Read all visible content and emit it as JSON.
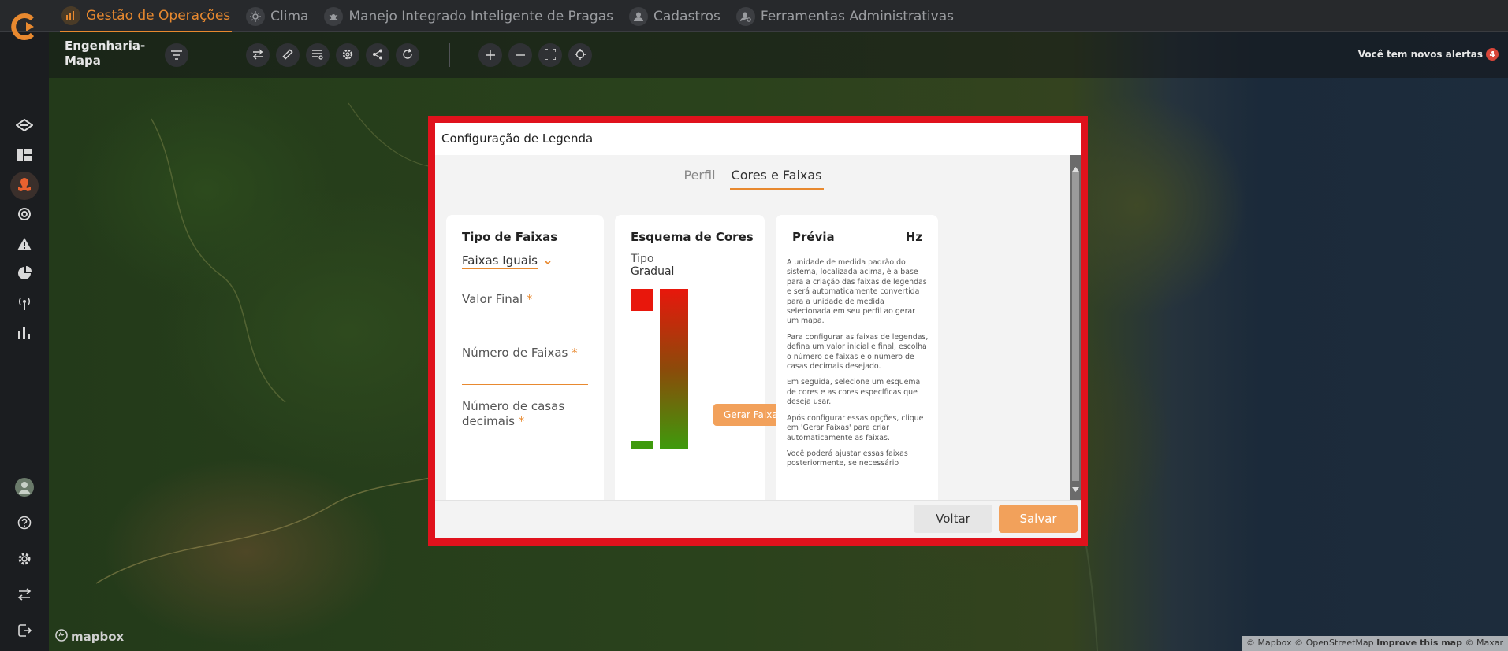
{
  "nav": {
    "items": [
      {
        "label": "Gestão de Operações",
        "active": true
      },
      {
        "label": "Clima",
        "active": false
      },
      {
        "label": "Manejo Integrado Inteligente de Pragas",
        "active": false
      },
      {
        "label": "Cadastros",
        "active": false
      },
      {
        "label": "Ferramentas Administrativas",
        "active": false
      }
    ]
  },
  "map": {
    "title": "Engenharia-Mapa",
    "alerts_label": "Você tem novos alertas",
    "alerts_count": "4",
    "brand": "mapbox",
    "attribution": {
      "mapbox": "© Mapbox",
      "osm": "© OpenStreetMap",
      "improve": "Improve this map",
      "maxar": "© Maxar"
    }
  },
  "modal": {
    "title": "Configuração de Legenda",
    "tabs": [
      {
        "label": "Perfil",
        "active": false
      },
      {
        "label": "Cores e Faixas",
        "active": true
      }
    ],
    "tipo_faixas": {
      "title": "Tipo de Faixas",
      "selected": "Faixas Iguais",
      "valor_final_label": "Valor Final",
      "numero_faixas_label": "Número de Faixas",
      "casas_decimais_label": "Número de casas decimais",
      "required_mark": "*"
    },
    "esquema_cores": {
      "title": "Esquema de Cores",
      "tipo_label": "Tipo",
      "tipo_value": "Gradual",
      "gerar_button": "Gerar Faixas",
      "color_start": "#e8170c",
      "color_end": "#3e9a0c"
    },
    "previa": {
      "title": "Prévia",
      "unit": "Hz",
      "help": [
        "A unidade de medida padrão do sistema, localizada acima, é a base para a criação das faixas de legendas e será automaticamente convertida para a unidade de medida selecionada em seu perfil ao gerar um mapa.",
        "Para configurar as faixas de legendas, defina um valor inicial e final, escolha o número de faixas e o número de casas decimais desejado.",
        "Em seguida, selecione um esquema de cores e as cores específicas que deseja usar.",
        "Após configurar essas opções, clique em 'Gerar Faixas' para criar automaticamente as faixas.",
        "Você poderá ajustar essas faixas posteriormente, se necessário"
      ]
    },
    "footer": {
      "voltar": "Voltar",
      "salvar": "Salvar"
    }
  },
  "colors": {
    "accent": "#e8892f",
    "highlight_border": "#e0121c"
  }
}
